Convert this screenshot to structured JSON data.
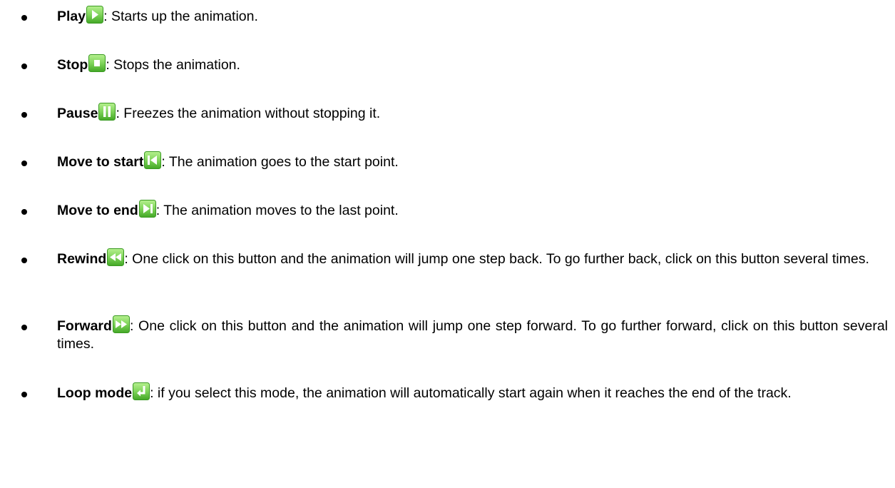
{
  "items": [
    {
      "term": "Play",
      "icon": "play-icon",
      "description": ": Starts up the animation."
    },
    {
      "term": "Stop",
      "icon": "stop-icon",
      "description": ": Stops the animation."
    },
    {
      "term": "Pause",
      "icon": "pause-icon",
      "description": ": Freezes the animation without stopping it."
    },
    {
      "term": "Move to start",
      "icon": "skip-to-start-icon",
      "description": ": The animation goes to the start point."
    },
    {
      "term": "Move to end",
      "icon": "skip-to-end-icon",
      "description": ": The animation moves to the last point."
    },
    {
      "term": "Rewind",
      "icon": "rewind-icon",
      "description": ": One click on this button and the animation will jump one step back. To go further back, click on this button several times."
    },
    {
      "term": "Forward",
      "icon": "fast-forward-icon",
      "description": ": One click on this button and the animation will jump one step forward. To go further forward, click on this button several times."
    },
    {
      "term": "Loop mode",
      "icon": "loop-icon",
      "description": ": if you select this mode, the animation will automatically start again when it reaches the end of the track."
    }
  ],
  "colors": {
    "button_green_light": "#9ee57a",
    "button_green_dark": "#49b32c",
    "button_symbol": "#ffffff",
    "text": "#000000"
  }
}
